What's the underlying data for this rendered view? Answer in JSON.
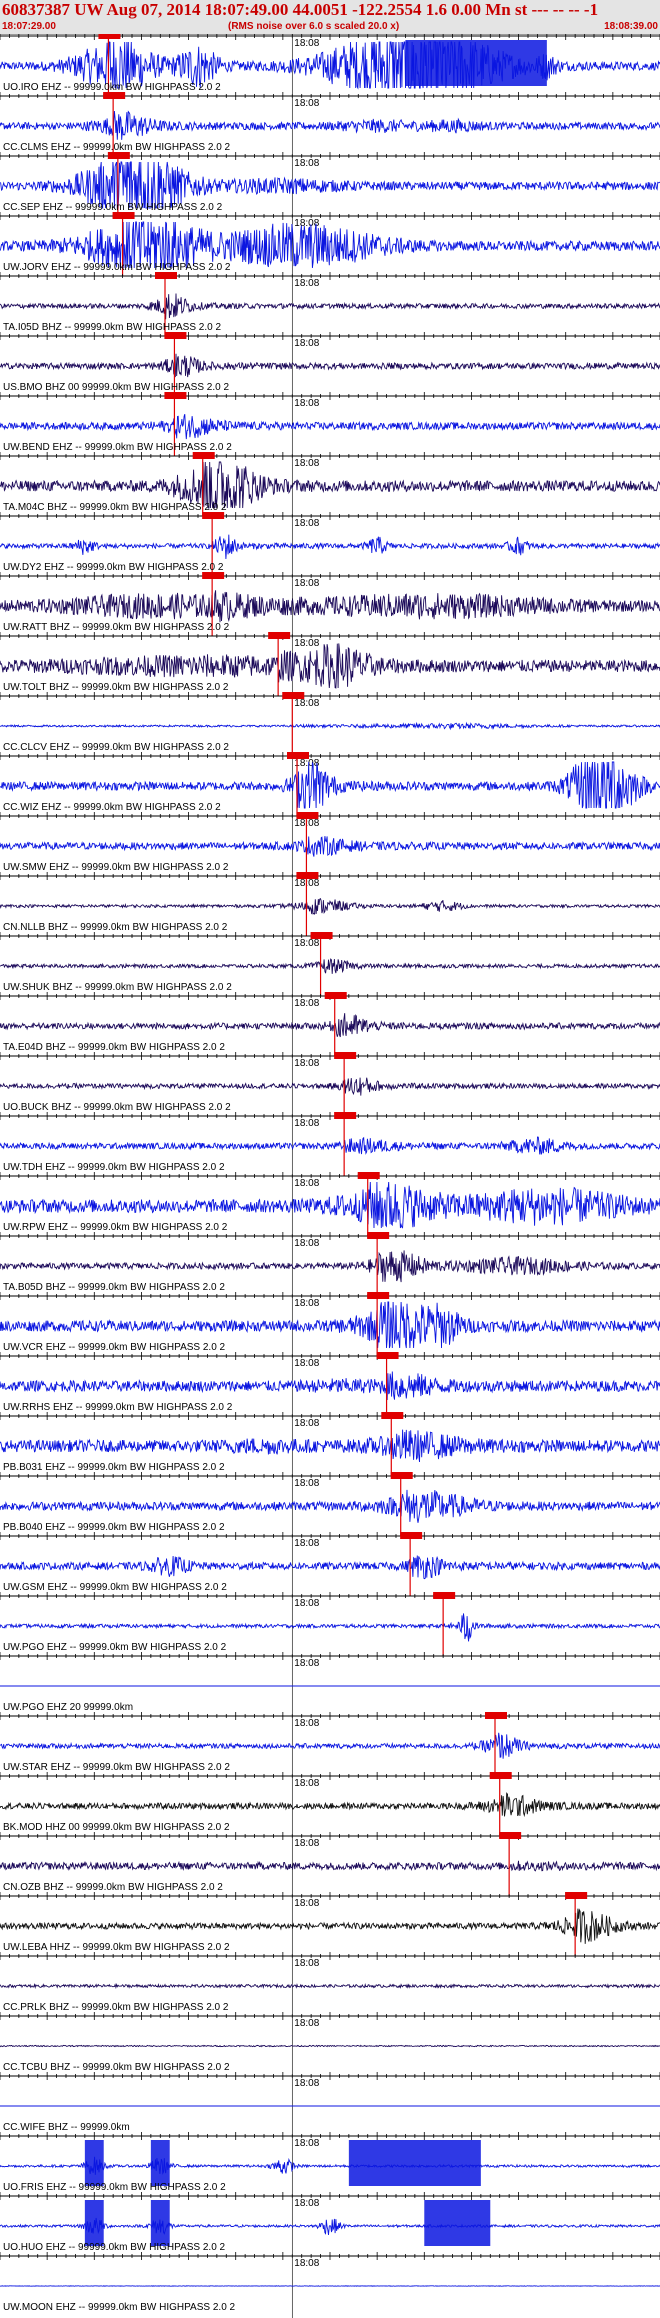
{
  "header": {
    "title": "60837387 UW Aug 07, 2014 18:07:49.00   44.0051 -122.2554  1.6 0.00 Mn st --- -- --  -1",
    "start_time": "18:07:29.00",
    "subtitle": "(RMS noise over 6.0 s scaled 20.0 x)",
    "end_time": "18:08:39.00"
  },
  "colors": {
    "trace_blue": "#0b16e0",
    "trace_navy": "#1c0a5a",
    "trace_black": "#111111",
    "pick_red": "#e00000",
    "axis_black": "#000000"
  },
  "chart_data": {
    "type": "seismogram-record-section",
    "time_axis": {
      "start": "18:07:29.00",
      "end": "18:08:39.00",
      "minute_label": "18:08"
    },
    "traces": [
      {
        "label": "UO.IRO EHZ -- 99999.0km BW  HIGHPASS  2.0  2",
        "color": "blue",
        "pick_s": 11.5,
        "amp": 0.35,
        "bursts": [
          [
            12,
            4,
            6
          ],
          [
            21,
            2,
            5
          ],
          [
            44,
            8,
            12
          ],
          [
            58,
            1,
            3
          ]
        ],
        "clip": [
          [
            43,
            58
          ]
        ]
      },
      {
        "label": "CC.CLMS EHZ -- 99999.0km BW  HIGHPASS  2.0  2",
        "color": "blue",
        "pick_s": 12,
        "amp": 0.3,
        "bursts": [
          [
            13,
            3,
            3
          ],
          [
            40,
            4,
            2
          ],
          [
            48,
            3,
            2
          ]
        ]
      },
      {
        "label": "CC.SEP EHZ -- 99999.0km BW  HIGHPASS  2.0  2",
        "color": "blue",
        "pick_s": 12.5,
        "amp": 0.35,
        "bursts": [
          [
            14,
            5,
            9
          ],
          [
            30,
            6,
            2
          ]
        ]
      },
      {
        "label": "UW.JORV EHZ -- 99999.0km BW  HIGHPASS  2.0  2",
        "color": "blue",
        "pick_s": 13,
        "amp": 0.4,
        "bursts": [
          [
            15,
            6,
            6
          ],
          [
            32,
            8,
            5
          ]
        ]
      },
      {
        "label": "TA.I05D BHZ -- 99999.0km BW  HIGHPASS  2.0  2",
        "color": "navy",
        "pick_s": 17.5,
        "amp": 0.2,
        "bursts": [
          [
            18,
            2,
            4
          ]
        ]
      },
      {
        "label": "US.BMO BHZ 00 99999.0km BW  HIGHPASS  2.0  2",
        "color": "navy",
        "pick_s": 18.5,
        "amp": 0.25,
        "bursts": [
          [
            19,
            2,
            3
          ]
        ]
      },
      {
        "label": "UW.BEND EHZ -- 99999.0km BW  HIGHPASS  2.0  2",
        "color": "blue",
        "pick_s": 18.5,
        "amp": 0.3,
        "bursts": [
          [
            20,
            3,
            2.5
          ]
        ]
      },
      {
        "label": "TA.M04C BHZ -- 99999.0km BW  HIGHPASS  2.0  2",
        "color": "navy",
        "pick_s": 21.5,
        "amp": 0.45,
        "bursts": [
          [
            23,
            4,
            5
          ]
        ]
      },
      {
        "label": "UW.DY2 EHZ -- 99999.0km BW  HIGHPASS  2.0  2",
        "color": "blue",
        "pick_s": 22.5,
        "amp": 0.2,
        "bursts": [
          [
            24,
            1,
            4
          ],
          [
            9,
            1,
            4
          ],
          [
            40,
            1,
            4
          ],
          [
            55,
            1,
            4
          ]
        ]
      },
      {
        "label": "UW.RATT BHZ -- 99999.0km BW  HIGHPASS  2.0  2",
        "color": "navy",
        "pick_s": 22.5,
        "amp": 0.45,
        "bursts": [
          [
            17,
            10,
            2.5
          ],
          [
            46,
            12,
            2.5
          ]
        ]
      },
      {
        "label": "UW.TOLT BHZ -- 99999.0km BW  HIGHPASS  2.0  2",
        "color": "navy",
        "pick_s": 29.5,
        "amp": 0.5,
        "bursts": [
          [
            22,
            14,
            2
          ],
          [
            36,
            3,
            3
          ]
        ]
      },
      {
        "label": "CC.CLCV EHZ -- 99999.0km BW  HIGHPASS  2.0  2",
        "color": "blue",
        "pick_s": 31,
        "amp": 0.08,
        "bursts": [
          [
            48,
            8,
            3
          ]
        ]
      },
      {
        "label": "CC.WIZ EHZ -- 99999.0km BW  HIGHPASS  2.0  2",
        "color": "blue",
        "pick_s": 31.5,
        "amp": 0.35,
        "bursts": [
          [
            33,
            2,
            5
          ],
          [
            64,
            3,
            12
          ]
        ]
      },
      {
        "label": "UW.SMW EHZ -- 99999.0km BW  HIGHPASS  2.0  2",
        "color": "blue",
        "pick_s": 32.5,
        "amp": 0.3,
        "bursts": [
          [
            34,
            3,
            2
          ]
        ]
      },
      {
        "label": "CN.NLLB BHZ -- 99999.0km BW  HIGHPASS  2.0  2",
        "color": "navy",
        "pick_s": 32.5,
        "amp": 0.12,
        "bursts": [
          [
            34,
            3,
            4
          ],
          [
            47,
            2,
            4
          ]
        ]
      },
      {
        "label": "UW.SHUK BHZ -- 99999.0km BW  HIGHPASS  2.0  2",
        "color": "navy",
        "pick_s": 34,
        "amp": 0.15,
        "bursts": [
          [
            35,
            2,
            3
          ]
        ]
      },
      {
        "label": "TA.E04D BHZ -- 99999.0km BW  HIGHPASS  2.0  2",
        "color": "navy",
        "pick_s": 35.5,
        "amp": 0.25,
        "bursts": [
          [
            37,
            2,
            3
          ]
        ]
      },
      {
        "label": "UO.BUCK BHZ -- 99999.0km BW  HIGHPASS  2.0  2",
        "color": "navy",
        "pick_s": 36.5,
        "amp": 0.2,
        "bursts": [
          [
            38,
            2,
            3
          ]
        ]
      },
      {
        "label": "UW.TDH EHZ -- 99999.0km BW  HIGHPASS  2.0  2",
        "color": "blue",
        "pick_s": 36.5,
        "amp": 0.25,
        "bursts": [
          [
            39,
            3,
            2
          ],
          [
            57,
            3,
            3
          ]
        ]
      },
      {
        "label": "UW.RPW EHZ -- 99999.0km BW  HIGHPASS  2.0  2",
        "color": "blue",
        "pick_s": 39,
        "amp": 0.55,
        "bursts": [
          [
            41,
            5,
            3
          ],
          [
            58,
            8,
            3
          ]
        ]
      },
      {
        "label": "TA.B05D BHZ -- 99999.0km BW  HIGHPASS  2.0  2",
        "color": "navy",
        "pick_s": 40,
        "amp": 0.25,
        "bursts": [
          [
            42,
            3,
            4
          ],
          [
            55,
            6,
            3
          ]
        ]
      },
      {
        "label": "UW.VCR EHZ -- 99999.0km BW  HIGHPASS  2.0  2",
        "color": "blue",
        "pick_s": 40,
        "amp": 0.45,
        "bursts": [
          [
            42,
            4,
            4
          ],
          [
            47,
            2,
            3
          ]
        ]
      },
      {
        "label": "UW.RRHS EHZ -- 99999.0km BW  HIGHPASS  2.0  2",
        "color": "blue",
        "pick_s": 41,
        "amp": 0.45,
        "bursts": [
          [
            43,
            3,
            2
          ],
          [
            36,
            3,
            1.5
          ]
        ]
      },
      {
        "label": "PB.B031 EHZ -- 99999.0km BW  HIGHPASS  2.0  2",
        "color": "blue",
        "pick_s": 41.5,
        "amp": 0.5,
        "bursts": [
          [
            44,
            5,
            2
          ],
          [
            28,
            4,
            1.5
          ]
        ]
      },
      {
        "label": "PB.B040 EHZ -- 99999.0km BW  HIGHPASS  2.0  2",
        "color": "blue",
        "pick_s": 42.5,
        "amp": 0.35,
        "bursts": [
          [
            45,
            5,
            3
          ]
        ]
      },
      {
        "label": "UW.GSM EHZ -- 99999.0km BW  HIGHPASS  2.0  2",
        "color": "blue",
        "pick_s": 43.5,
        "amp": 0.3,
        "bursts": [
          [
            18,
            2,
            3
          ],
          [
            45,
            2,
            2.5
          ]
        ]
      },
      {
        "label": "UW.PGO EHZ -- 99999.0km BW  HIGHPASS  2.0  2",
        "color": "blue",
        "pick_s": 47,
        "amp": 0.15,
        "bursts": [
          [
            49.5,
            0.6,
            8
          ]
        ]
      },
      {
        "label": "UW.PGO EHZ 20 99999.0km",
        "color": "blue",
        "pick_s": 0,
        "amp": 0,
        "bursts": []
      },
      {
        "label": "UW.STAR EHZ -- 99999.0km BW  HIGHPASS  2.0  2",
        "color": "blue",
        "pick_s": 52.5,
        "amp": 0.2,
        "bursts": [
          [
            53,
            2,
            4
          ]
        ]
      },
      {
        "label": "BK.MOD HHZ 00 99999.0km BW  HIGHPASS  2.0  2",
        "color": "black",
        "pick_s": 53,
        "amp": 0.25,
        "bursts": [
          [
            54,
            3,
            3
          ]
        ]
      },
      {
        "label": "CN.OZB BHZ -- 99999.0km BW  HIGHPASS  2.0  2",
        "color": "navy",
        "pick_s": 54,
        "amp": 0.3,
        "bursts": []
      },
      {
        "label": "UW.LEBA HHZ -- 99999.0km BW  HIGHPASS  2.0  2",
        "color": "black",
        "pick_s": 61,
        "amp": 0.25,
        "bursts": [
          [
            62,
            3,
            4
          ]
        ]
      },
      {
        "label": "CC.PRLK BHZ -- 99999.0km BW  HIGHPASS  2.0  2",
        "color": "navy",
        "pick_s": 0,
        "amp": 0.12,
        "bursts": []
      },
      {
        "label": "CC.TCBU BHZ -- 99999.0km BW  HIGHPASS  2.0  2",
        "color": "navy",
        "pick_s": 0,
        "amp": 0.05,
        "bursts": []
      },
      {
        "label": "CC.WIFE BHZ -- 99999.0km",
        "color": "blue",
        "pick_s": 0,
        "amp": 0,
        "bursts": []
      },
      {
        "label": "UO.FRIS EHZ -- 99999.0km BW  HIGHPASS  2.0  2",
        "color": "blue",
        "pick_s": 0,
        "amp": 0.1,
        "bursts": [
          [
            10,
            1,
            8
          ],
          [
            17,
            1,
            8
          ],
          [
            30,
            1,
            8
          ]
        ],
        "clip": [
          [
            9,
            11
          ],
          [
            16,
            18
          ],
          [
            37,
            51
          ]
        ]
      },
      {
        "label": "UO.HUO EHZ -- 99999.0km BW  HIGHPASS  2.0  2",
        "color": "blue",
        "pick_s": 0,
        "amp": 0.1,
        "bursts": [
          [
            10,
            1,
            8
          ],
          [
            17,
            1,
            8
          ],
          [
            35,
            1,
            8
          ]
        ],
        "clip": [
          [
            9,
            11
          ],
          [
            16,
            18
          ],
          [
            45,
            52
          ]
        ]
      },
      {
        "label": "UW.MOON EHZ -- 99999.0km BW  HIGHPASS  2.0  2",
        "color": "blue",
        "pick_s": 0,
        "amp": 0.02,
        "bursts": []
      }
    ]
  }
}
